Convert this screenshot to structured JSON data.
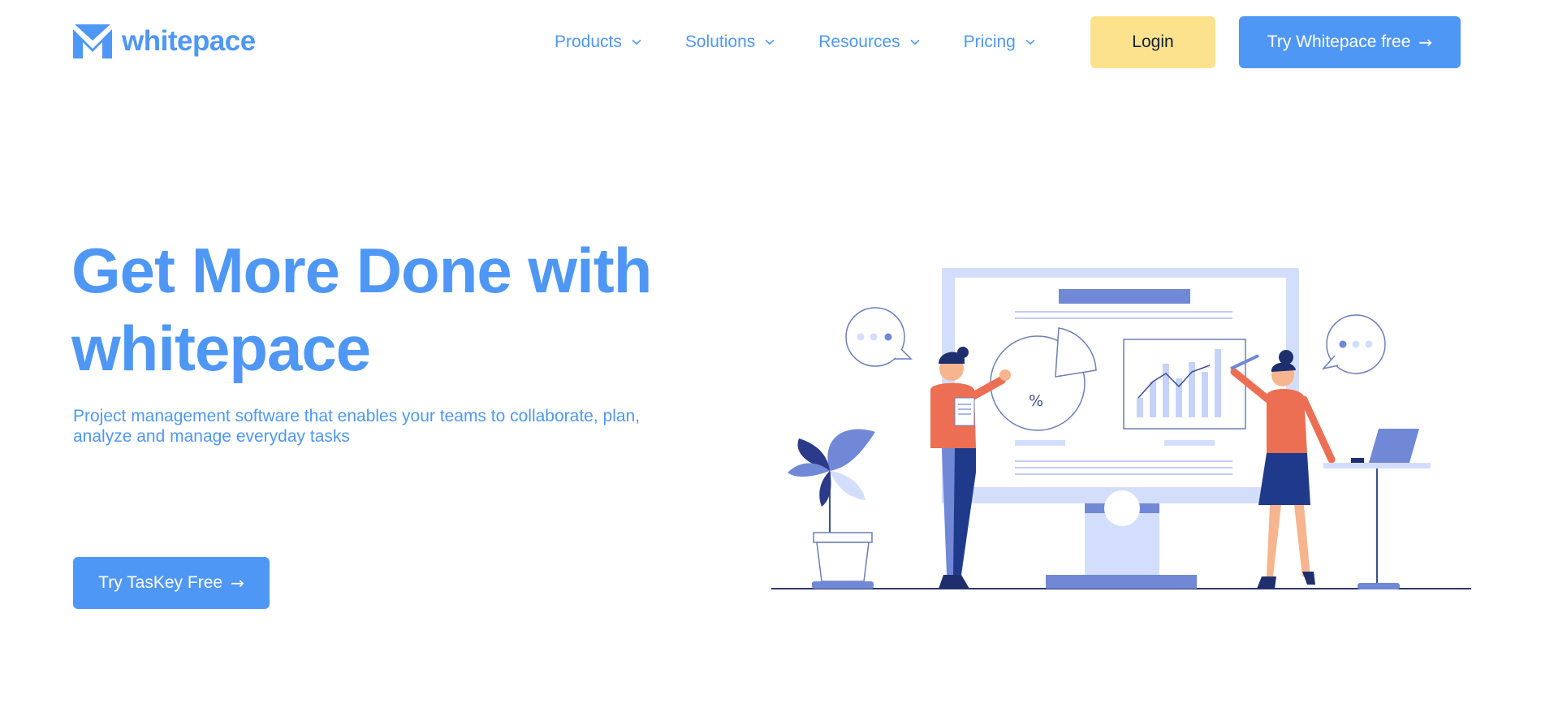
{
  "brand": {
    "name": "whitepace",
    "logo_icon": "whitepace-logo-icon",
    "color": "#4f97f4"
  },
  "nav": {
    "items": [
      {
        "label": "Products"
      },
      {
        "label": "Solutions"
      },
      {
        "label": "Resources"
      },
      {
        "label": "Pricing"
      }
    ]
  },
  "header": {
    "login_label": "Login",
    "try_label": "Try Whitepace free",
    "try_arrow": "→",
    "login_bg": "#fde28e",
    "try_bg": "#4f97f4"
  },
  "hero": {
    "title_line1": "Get More Done with",
    "title_line2": "whitepace",
    "subtitle": "Project management software that enables your teams to collaborate, plan, analyze and manage everyday tasks",
    "cta_label": "Try TasKey Free",
    "cta_arrow": "→"
  },
  "illustration": {
    "percent_label": "%",
    "icon": "team-presentation-illustration"
  }
}
